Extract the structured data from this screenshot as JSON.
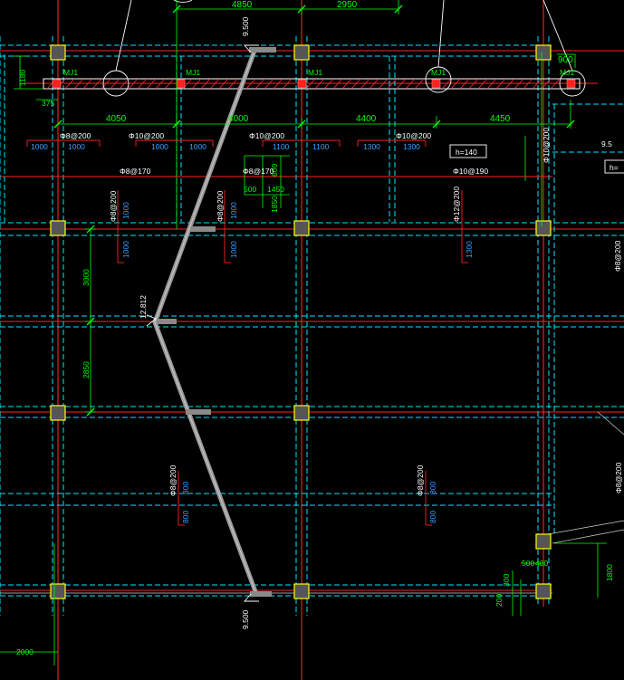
{
  "drawing": {
    "elevation_labels": [
      "9.500",
      "12.812",
      "9.500",
      "9.5"
    ],
    "mj_labels": [
      "MJ1",
      "MJ1",
      "MJ1",
      "MJ1",
      "MJ1"
    ],
    "dimensions_top": [
      "4850",
      "2950",
      "900"
    ],
    "dimensions_span": [
      "4050",
      "4000",
      "4400",
      "4450"
    ],
    "dimensions_misc": [
      "1180",
      "375",
      "600",
      "500",
      "1450",
      "1850",
      "3000",
      "2850",
      "1800",
      "500",
      "400",
      "300",
      "200",
      "2000"
    ],
    "rebar_labels": [
      "Φ8@200",
      "Φ10@200",
      "Φ10@200",
      "Φ10@200",
      "Φ8@200",
      "Φ8@200",
      "Φ8@200",
      "Φ12@200",
      "Φ8@200",
      "Φ8@200",
      "Φ8@200"
    ],
    "rebar_note_right": [
      "Φ10@200",
      "Φ8@170",
      "Φ8@170",
      "Φ10@190"
    ],
    "blue_lengths": [
      "1000",
      "1000",
      "1000",
      "1000",
      "1100",
      "1100",
      "1300",
      "1300",
      "1000",
      "1000",
      "1000",
      "1000",
      "1300",
      "800",
      "800",
      "800",
      "800"
    ],
    "slab_thickness": "h=140",
    "slab_thickness_cut": "h="
  },
  "colors": {
    "axis": "#ff2020",
    "beam": "#00e5ff",
    "dimension": "#00ff00",
    "blue_text": "#3aa0ff",
    "column": "#ffff00",
    "ramp": "#a0a0a0"
  }
}
